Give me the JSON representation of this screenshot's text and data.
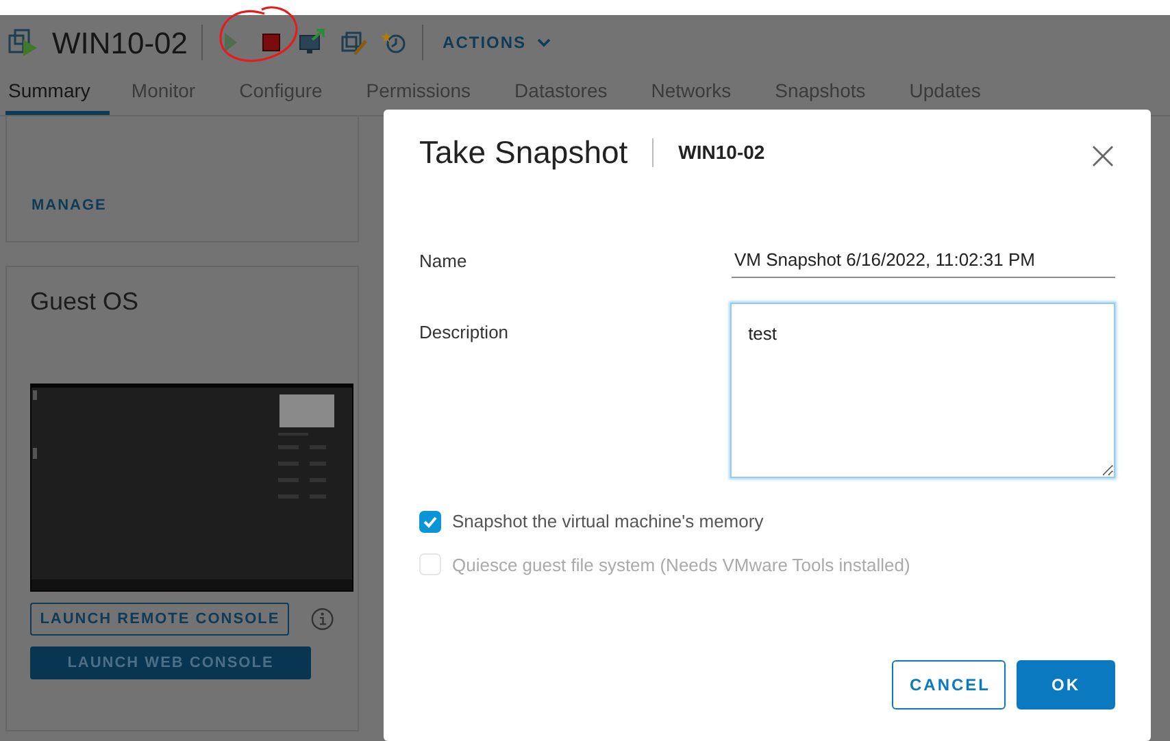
{
  "vm": {
    "name": "WIN10-02"
  },
  "toolbar": [
    {
      "kind": "play",
      "disabled": true
    },
    {
      "kind": "stop",
      "disabled": false
    },
    {
      "kind": "console",
      "disabled": false
    },
    {
      "kind": "edit",
      "disabled": false
    },
    {
      "kind": "snapshot",
      "disabled": false
    }
  ],
  "actions_menu": {
    "label": "ACTIONS"
  },
  "tabs": [
    {
      "label": "Summary",
      "selected": true
    },
    {
      "label": "Monitor",
      "selected": false
    },
    {
      "label": "Configure",
      "selected": false
    },
    {
      "label": "Permissions",
      "selected": false
    },
    {
      "label": "Datastores",
      "selected": false
    },
    {
      "label": "Networks",
      "selected": false
    },
    {
      "label": "Snapshots",
      "selected": false
    },
    {
      "label": "Updates",
      "selected": false
    }
  ],
  "manage_link": "MANAGE",
  "guest_os": {
    "title": "Guest OS",
    "buttons": [
      {
        "label": "LAUNCH REMOTE CONSOLE",
        "kind": "outline"
      },
      {
        "label": "LAUNCH WEB CONSOLE",
        "kind": "solid"
      }
    ]
  },
  "dialog": {
    "title": "Take Snapshot",
    "subtitle": "WIN10-02",
    "fields": [
      {
        "label": "Name",
        "kind": "input",
        "value": "VM Snapshot 6/16/2022, 11:02:31 PM",
        "focused": false
      },
      {
        "label": "Description",
        "kind": "textarea",
        "value": "test",
        "focused": true
      }
    ],
    "options": [
      {
        "label": "Snapshot the virtual machine's memory",
        "checked": true,
        "disabled": false
      },
      {
        "label": "Quiesce guest file system (Needs VMware Tools installed)",
        "checked": false,
        "disabled": true
      }
    ],
    "buttons": [
      {
        "label": "CANCEL",
        "kind": "outline"
      },
      {
        "label": "OK",
        "kind": "primary"
      }
    ]
  }
}
